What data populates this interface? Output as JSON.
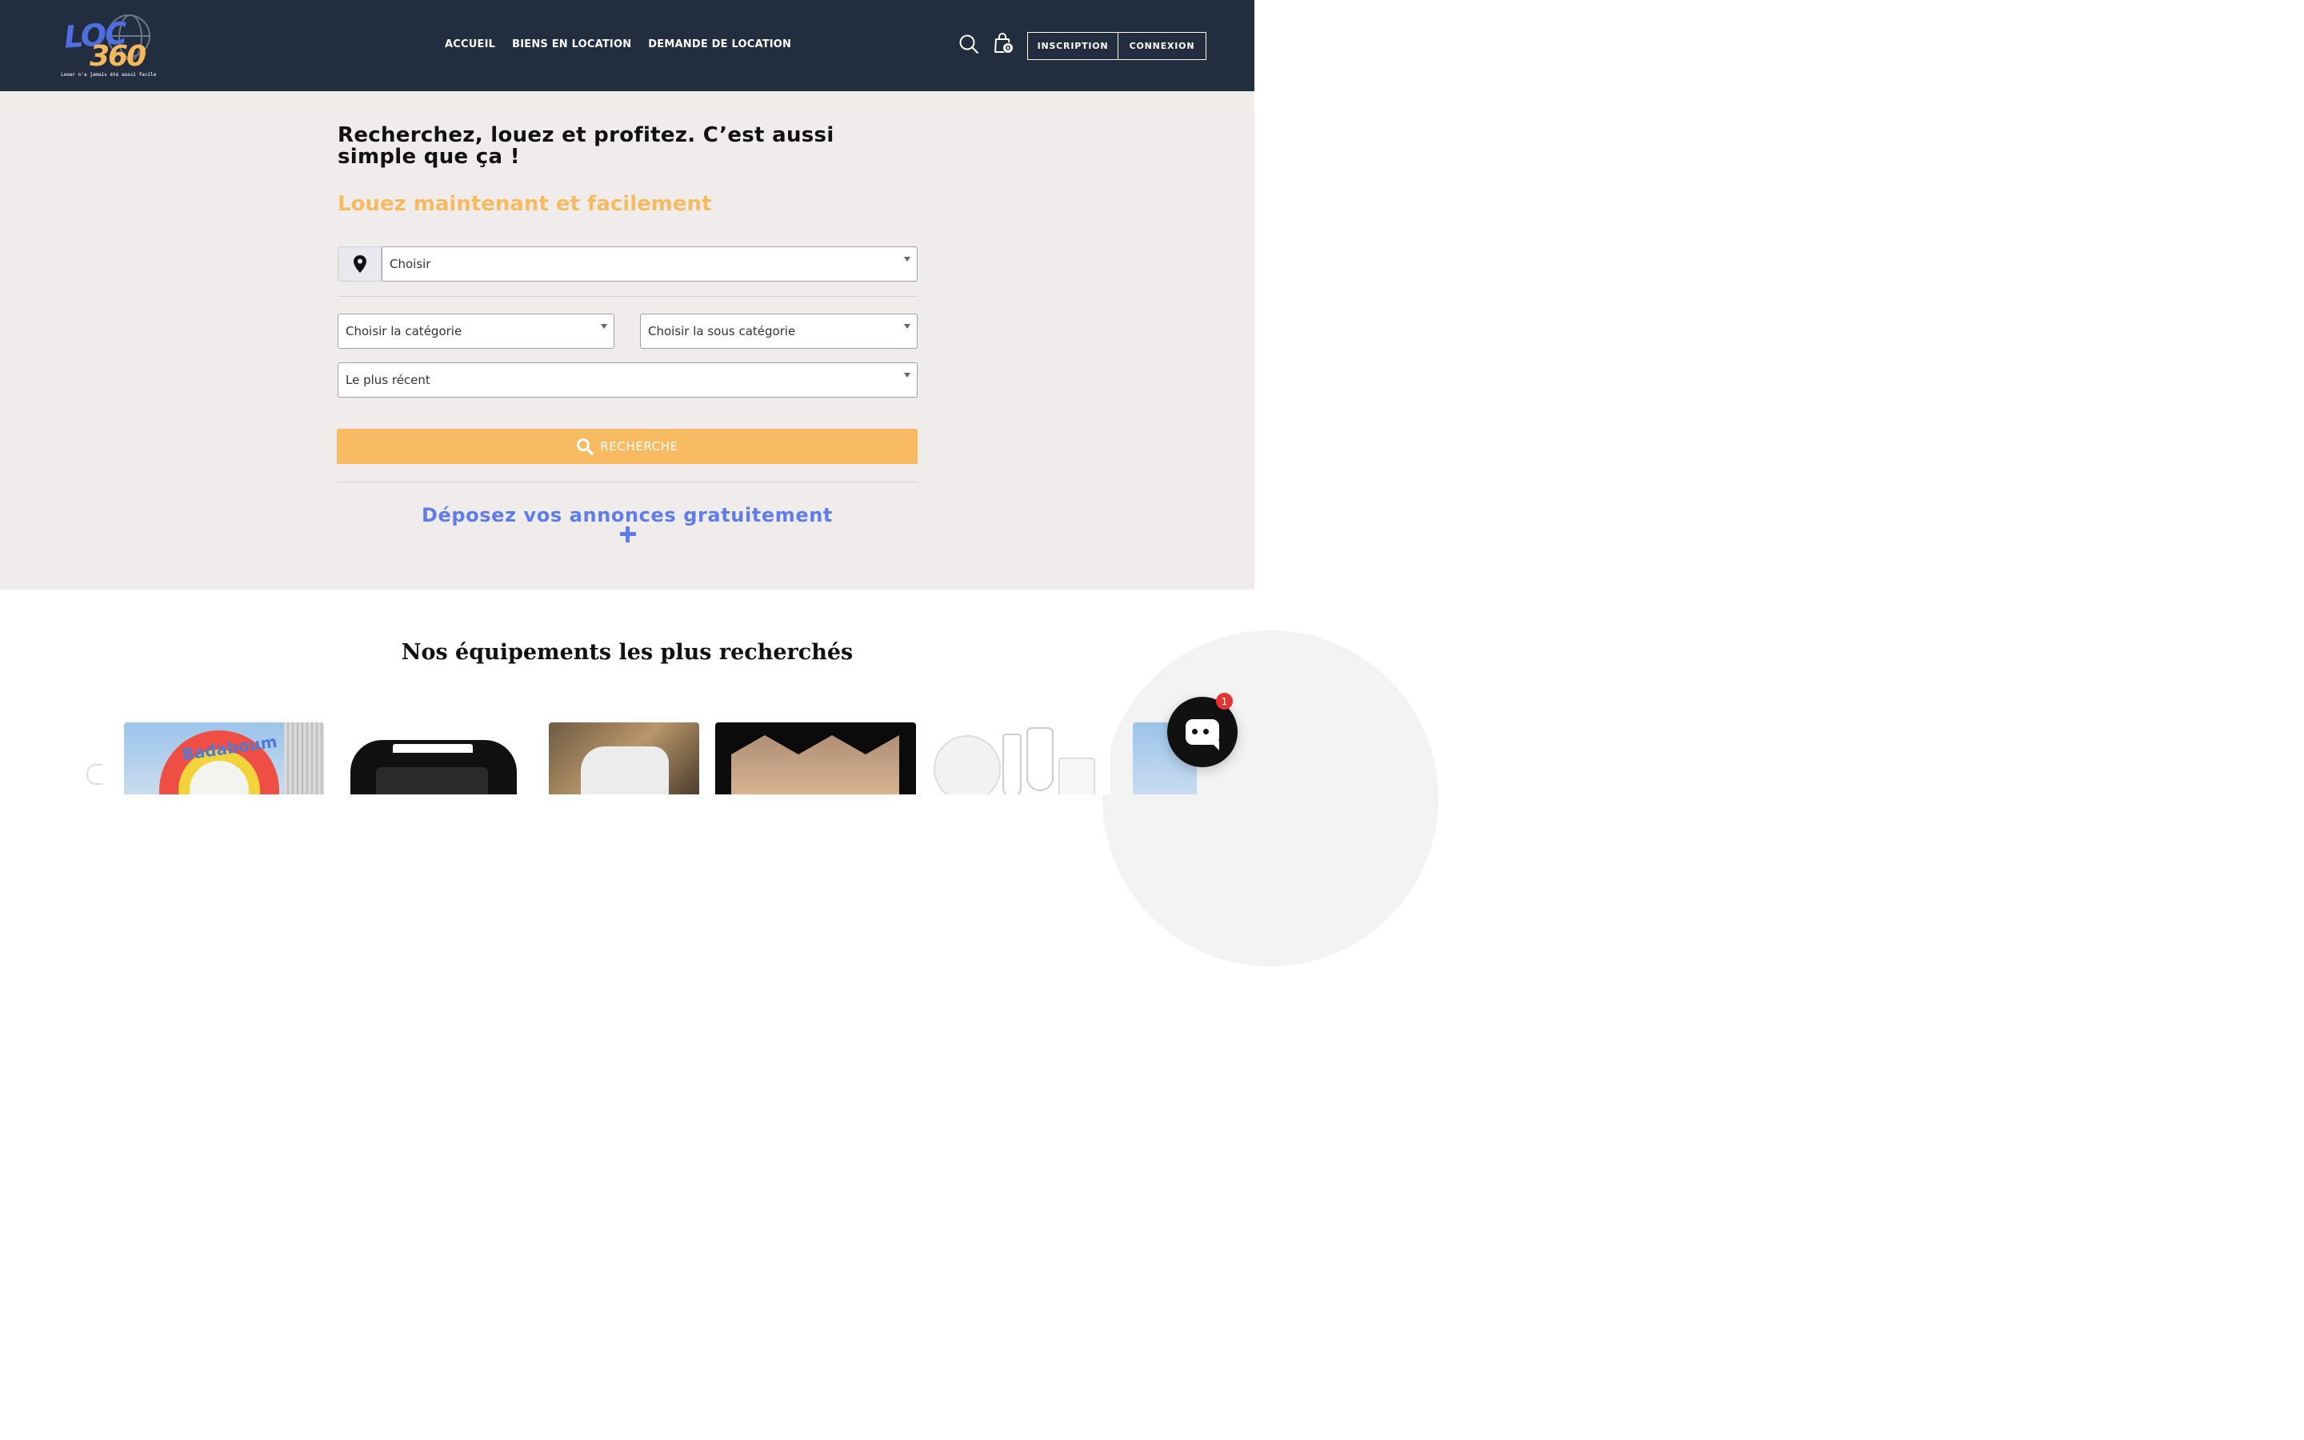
{
  "header": {
    "logo_text_main": "LOC",
    "logo_text_num": "360",
    "logo_tagline": "Louer n'a jamais été aussi facile",
    "nav": [
      "ACCUEIL",
      "BIENS EN LOCATION",
      "DEMANDE DE LOCATION"
    ],
    "cart_count": "0",
    "signup_label": "INSCRIPTION",
    "login_label": "CONNEXION",
    "colors": {
      "background": "#222d3f",
      "text": "#ffffff"
    }
  },
  "hero": {
    "title": "Recherchez, louez et profitez. C’est aussi simple que ça !",
    "subtitle": "Louez maintenant et facilement",
    "location_select": "Choisir",
    "category_select": "Choisir la catégorie",
    "subcategory_select": "Choisir la sous catégorie",
    "sort_select": "Le plus récent",
    "search_button": "RECHERCHE",
    "deposit_link": "Déposez vos annonces gratuitement",
    "colors": {
      "background": "#efeceb",
      "accent": "#f8bb62",
      "link": "#5f7cec"
    }
  },
  "section": {
    "title": "Nos équipements les plus recherchés",
    "card_badge_text": "Badaboum"
  },
  "chat": {
    "badge_count": "1"
  },
  "icons": [
    "location-pin-icon",
    "search-icon",
    "cart-icon",
    "chat-icon",
    "plus-icon"
  ]
}
